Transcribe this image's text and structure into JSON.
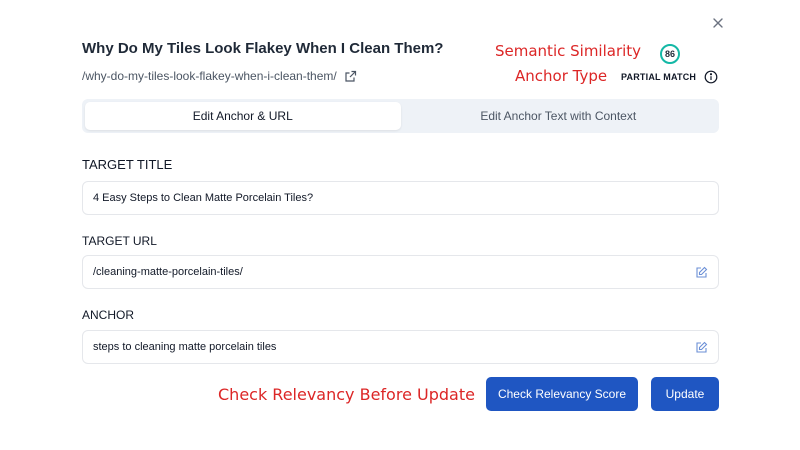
{
  "header": {
    "title": "Why Do My Tiles Look Flakey When I Clean Them?",
    "source_url": "/why-do-my-tiles-look-flakey-when-i-clean-them/"
  },
  "annotations": {
    "semantic_similarity": "Semantic Similarity",
    "anchor_type": "Anchor Type",
    "check_relevancy": "Check Relevancy Before Update"
  },
  "metrics": {
    "similarity_score": "86",
    "anchor_type_value": "PARTIAL MATCH"
  },
  "tabs": [
    {
      "label": "Edit Anchor & URL",
      "active": true
    },
    {
      "label": "Edit Anchor Text with Context",
      "active": false
    }
  ],
  "form": {
    "target_title_label": "TARGET TITLE",
    "target_title_value": "4 Easy Steps to Clean Matte Porcelain Tiles?",
    "target_url_label": "TARGET URL",
    "target_url_value": "/cleaning-matte-porcelain-tiles/",
    "anchor_label": "ANCHOR",
    "anchor_value": "steps to cleaning matte porcelain tiles"
  },
  "buttons": {
    "check_relevancy": "Check Relevancy Score",
    "update": "Update"
  },
  "icons": {
    "close": "close-icon",
    "external_link": "external-link-icon",
    "info": "info-icon",
    "edit": "edit-icon"
  },
  "colors": {
    "primary_button": "#1f56c2",
    "annotation_red": "#dc2626",
    "score_ring": "#14b8a6",
    "edit_icon": "#6b8fd6"
  }
}
